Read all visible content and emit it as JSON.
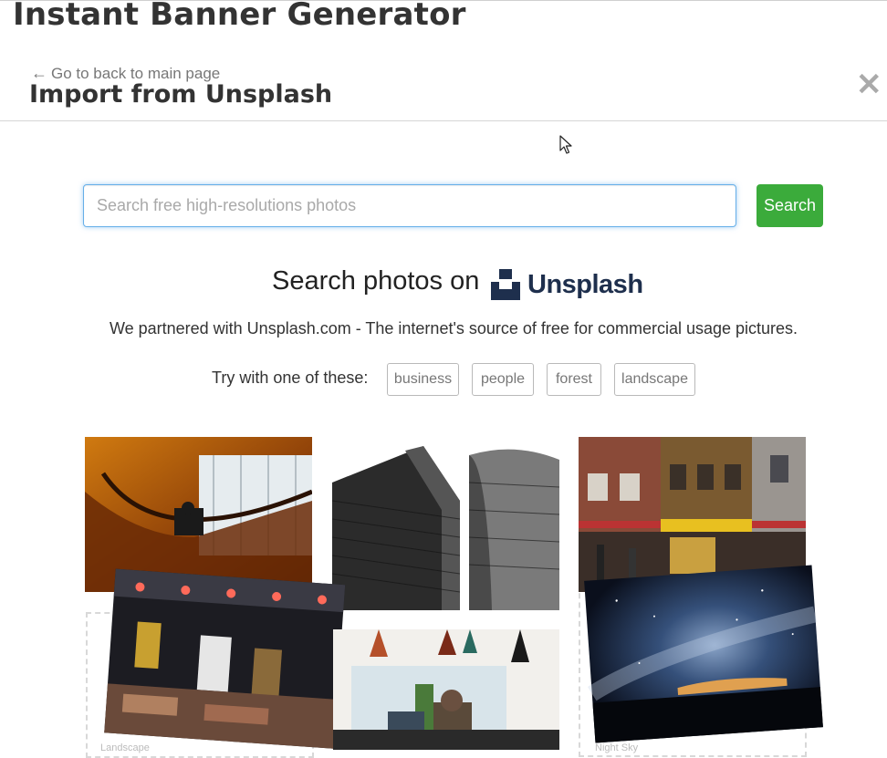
{
  "app": {
    "title": "Instant Banner Generator"
  },
  "modal": {
    "back_label": "Go to back to main page",
    "title": "Import from Unsplash",
    "close_label": "✕"
  },
  "search": {
    "placeholder": "Search free high-resolutions photos",
    "value": "",
    "button_label": "Search"
  },
  "hero": {
    "headline": "Search photos on",
    "brand": "Unsplash",
    "partner_text": "We partnered with Unsplash.com - The internet's source of free for commercial usage pictures.",
    "try_label": "Try with one of these:",
    "suggestions": [
      "business",
      "people",
      "forest",
      "landscape"
    ]
  },
  "gallery": {
    "captions": [
      "Landscape",
      "Night Sky"
    ]
  },
  "colors": {
    "accent_green": "#3bab3b",
    "focus_blue": "#66afe9",
    "brand_navy": "#1e2f4d"
  }
}
